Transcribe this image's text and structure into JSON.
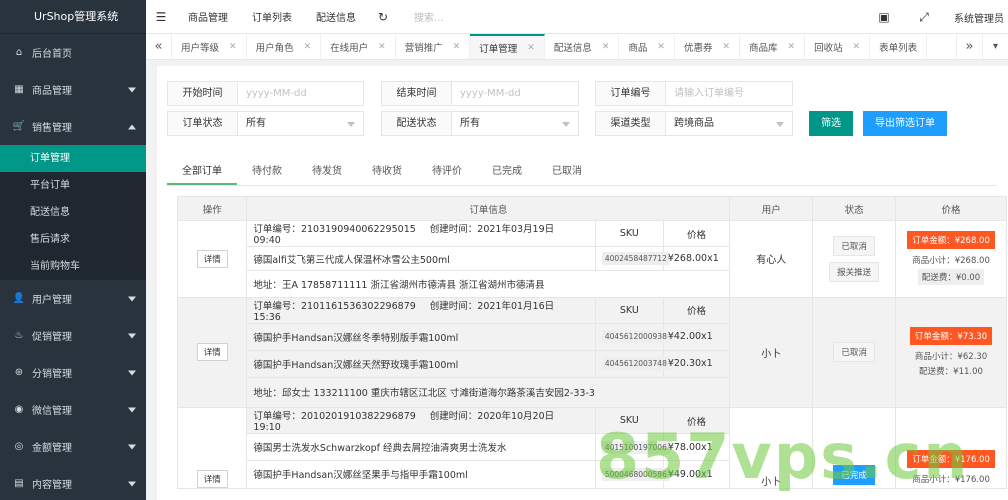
{
  "app": {
    "title": "UrShop管理系统"
  },
  "sidebar": {
    "items": [
      {
        "label": "后台首页",
        "icon": "home-icon"
      },
      {
        "label": "商品管理",
        "icon": "goods-icon",
        "caret": "down"
      },
      {
        "label": "销售管理",
        "icon": "cart-icon",
        "caret": "up"
      }
    ],
    "sub_items": [
      {
        "label": "订单管理",
        "active": true
      },
      {
        "label": "平台订单"
      },
      {
        "label": "配送信息"
      },
      {
        "label": "售后请求"
      },
      {
        "label": "当前购物车"
      }
    ],
    "items_after": [
      {
        "label": "用户管理",
        "icon": "user-icon"
      },
      {
        "label": "促销管理",
        "icon": "fire-icon"
      },
      {
        "label": "分销管理",
        "icon": "distribution-icon"
      },
      {
        "label": "微信管理",
        "icon": "wechat-icon"
      },
      {
        "label": "金额管理",
        "icon": "money-icon"
      },
      {
        "label": "内容管理",
        "icon": "content-icon"
      }
    ]
  },
  "topbar": {
    "links": [
      "商品管理",
      "订单列表",
      "配送信息"
    ],
    "search_placeholder": "搜索...",
    "admin": "系统管理员"
  },
  "tabs": [
    {
      "label": "用户等级"
    },
    {
      "label": "用户角色"
    },
    {
      "label": "在线用户"
    },
    {
      "label": "营销推广"
    },
    {
      "label": "订单管理",
      "active": true
    },
    {
      "label": "配送信息"
    },
    {
      "label": "商品"
    },
    {
      "label": "优惠券"
    },
    {
      "label": "商品库"
    },
    {
      "label": "回收站"
    },
    {
      "label": "表单列表"
    }
  ],
  "filters": {
    "start_time": {
      "label": "开始时间",
      "placeholder": "yyyy-MM-dd"
    },
    "end_time": {
      "label": "结束时间",
      "placeholder": "yyyy-MM-dd"
    },
    "order_no": {
      "label": "订单编号",
      "placeholder": "请输入订单编号"
    },
    "order_status": {
      "label": "订单状态",
      "value": "所有"
    },
    "delivery_status": {
      "label": "配送状态",
      "value": "所有"
    },
    "channel": {
      "label": "渠道类型",
      "value": "跨境商品"
    },
    "filter_btn": "筛选",
    "export_btn": "导出筛选订单"
  },
  "status_tabs": [
    "全部订单",
    "待付款",
    "待发货",
    "待收货",
    "待评价",
    "已完成",
    "已取消"
  ],
  "table": {
    "headers": {
      "op": "操作",
      "info": "订单信息",
      "user": "用户",
      "status": "状态",
      "price": "价格"
    },
    "detail_label": "详情",
    "order_no_prefix": "订单编号：",
    "created_prefix": "创建时间：",
    "sku_header": "SKU",
    "price_header": "价格",
    "address_prefix": "地址：",
    "total_prefix": "订单金额：",
    "subtotal_prefix": "商品小计：",
    "shipping_prefix": "配送费："
  },
  "orders": [
    {
      "order_no": "2103190940062295015",
      "created": "2021年03月19日 09:40",
      "items": [
        {
          "name": "德国alfi艾飞第三代成人保温杯冰雪公主500ml",
          "sku": "4002458487712",
          "price": "¥268.00x1"
        }
      ],
      "address": "王A 17858711111 浙江省湖州市德清县 浙江省湖州市德清县",
      "user": "有心人",
      "states": [
        "已取消",
        "报关推送"
      ],
      "total": "¥268.00",
      "subtotal": "¥268.00",
      "shipping": "¥0.00"
    },
    {
      "order_no": "2101161536302296879",
      "created": "2021年01月16日 15:36",
      "items": [
        {
          "name": "德国护手Handsan汉娜丝冬季特别版手霜100ml",
          "sku": "4045612000938",
          "price": "¥42.00x1"
        },
        {
          "name": "德国护手Handsan汉娜丝天然野玫瑰手霜100ml",
          "sku": "4045612003748",
          "price": "¥20.30x1"
        }
      ],
      "address": "邱女士 133211100 重庆市辖区江北区 寸滩街道海尔路茶溪吉安园2-33-3",
      "user": "小卜",
      "states": [
        "已取消"
      ],
      "total": "¥73.30",
      "subtotal": "¥62.30",
      "shipping": "¥11.00"
    },
    {
      "order_no": "2010201910382296879",
      "created": "2020年10月20日 19:10",
      "items": [
        {
          "name": "德国男士洗发水Schwarzkopf 经典去屑控油清爽男士洗发水",
          "sku": "4015100197006",
          "price": "¥78.00x1"
        },
        {
          "name": "德国护手Handsan汉娜丝坚果手与指甲手霜100ml",
          "sku": "5000468000586",
          "price": "¥49.00x1"
        }
      ],
      "user": "小卜",
      "states": [
        "已完成"
      ],
      "total": "¥176.00",
      "subtotal": "¥176.00"
    }
  ],
  "watermark": "857vps.cn"
}
